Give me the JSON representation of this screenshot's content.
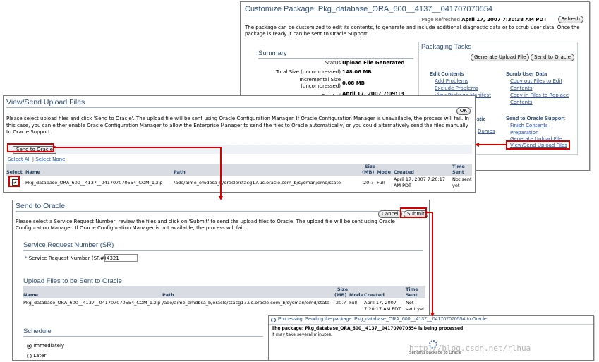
{
  "customize": {
    "title": "Customize Package: Pkg_database_ORA_600__4137__041707070554",
    "refreshed_label": "Page Refreshed",
    "refreshed_value": "April 17, 2007 7:30:38 AM PDT",
    "refresh_button": "Refresh",
    "intro": "The package can be customized to edit its contents, to generate and include additional diagnostic data or to scrub user data. Once the package is ready it can be sent to Oracle Support.",
    "summary_heading": "Summary",
    "summary": {
      "status_label": "Status",
      "status_value": "Upload File Generated",
      "total_label": "Total Size (uncompressed)",
      "total_value": "148.06 MB",
      "incr_label": "Incremental Size",
      "incr_label2": "(uncompressed)",
      "incr_value": "0.08 MB",
      "created_label": "Created",
      "created_value": "April 17, 2007 7:09:13"
    },
    "tasks_heading": "Packaging Tasks",
    "gen_button": "Generate Upload File",
    "send_button": "Send to Oracle",
    "edit_heading": "Edit Contents",
    "edit_links": [
      "Add Problems",
      "Exclude Problems",
      "View Package Manifest"
    ],
    "partial_diag": "ostic",
    "partial_dumps": "Dumps",
    "scrub_heading": "Scrub User Data",
    "scrub_links": [
      "Copy out Files to Edit",
      "Contents",
      "Copy in Files to Replace",
      "Contents"
    ],
    "support_heading": "Send to Oracle Support",
    "support_links": [
      "Finish Contents",
      "Preparation",
      "Generate Upload File",
      "View/Send Upload Files"
    ]
  },
  "viewsend": {
    "title": "View/Send Upload Files",
    "ok_button": "OK",
    "description": "Please select upload files and click 'Send to Oracle'. The upload file will be sent using Oracle Configuration Manager. If Oracle Configuration Manager is unavailable, the process will fail. In this case, you can either enable Oracle Configuration Manager to allow the Enterprise Manager to send the files to Oracle automatically, or you could alternatively send the files manually to Oracle Support.",
    "send_button": "Send to Oracle",
    "select_all": "Select All",
    "separator": "|",
    "select_none": "Select None",
    "headers": {
      "select": "Select",
      "name": "Name",
      "path": "Path",
      "size1": "Size",
      "size2": "(MB)",
      "mode": "Mode",
      "created": "Created",
      "time1": "Time",
      "time2": "Sent"
    },
    "row": {
      "checkbox": "✔",
      "name": "Pkg_database_ORA_600__4137__041707070554_COM_1.zip",
      "path": "/ade/aime_emdbsa_b/oracle/stacg17.us.oracle.com_b/sysman/emd/state",
      "size": "20.7",
      "mode": "Full",
      "created1": "April 17, 2007 7:20:17",
      "created2": "AM PDT",
      "sent1": "Not sent",
      "sent2": "yet"
    }
  },
  "sendoracle": {
    "title": "Send to Oracle",
    "cancel_button": "Cancel",
    "submit_button": "Submit",
    "description": "Please select a Service Request Number, review the files and click on 'Submit' to send the upload files to Oracle. The upload file will be sent using Oracle Configuration Manager. If Oracle Configuration Manager is not available, the process will fail.",
    "sr_heading": "Service Request Number (SR)",
    "sr_required": "*",
    "sr_label": "Service Request Number (SR#)",
    "sr_value": "4321",
    "upload_heading": "Upload Files to be Sent to Oracle",
    "headers": {
      "name": "Name",
      "path": "Path",
      "size1": "Size",
      "size2": "(MB)",
      "mode": "Mode",
      "created": "Created",
      "time1": "Time",
      "time2": "Sent"
    },
    "row": {
      "name": "Pkg_database_ORA_600__4137__041707070554_COM_1.zip",
      "path": "/ade/aime_emdbsa_b/oracle/stacg17.us.oracle.com_b/sysman/emd/state",
      "size": "20.7",
      "mode": "Full",
      "created1": "April 17, 2007",
      "created2": "7:20:17 AM PDT",
      "sent1": "Not",
      "sent2": "sent yet"
    },
    "schedule_heading": "Schedule",
    "opt_immediately": "Immediately",
    "opt_later": "Later"
  },
  "processing": {
    "title": "Processing: Sending the package: Pkg_database_ORA_600__4137__041707070554 to Oracle",
    "line1": "The package: Pkg_database_ORA_600__4137__041707070554 is being processed.",
    "line2": "It may take several minutes.",
    "status": "Sending package to Oracle"
  },
  "watermark": "http://blog.csdn.net/rlhua",
  "colors": {
    "highlight": "#d40000",
    "title": "#2e4f7a",
    "link": "#2a53a5",
    "header_bg": "#d9dde3"
  }
}
